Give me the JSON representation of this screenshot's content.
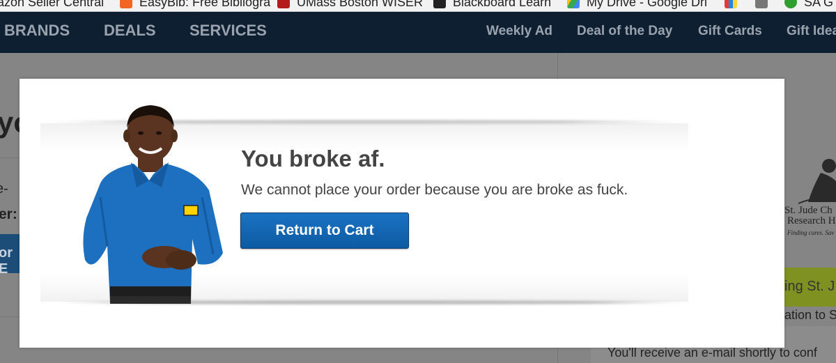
{
  "bookmarks": [
    {
      "label": "azon Seller Central",
      "icon": "amazon-icon",
      "color": "#f7f7f7"
    },
    {
      "label": "EasyBib: Free Bibliogra",
      "icon": "easybib-icon",
      "color": "#f26522"
    },
    {
      "label": "UMass Boston WISER",
      "icon": "umass-icon",
      "color": "#b31b1b"
    },
    {
      "label": "Blackboard Learn",
      "icon": "blackboard-icon",
      "color": "#222222"
    },
    {
      "label": "My Drive - Google Dri",
      "icon": "google-drive-icon",
      "color": "#34a853"
    },
    {
      "label": "SA G",
      "icon": "sa-icon",
      "color": "#2e9e2e"
    }
  ],
  "nav": {
    "left": [
      "BRANDS",
      "DEALS",
      "SERVICES"
    ],
    "right": [
      "Weekly Ad",
      "Deal of the Day",
      "Gift Cards",
      "Gift Idea"
    ]
  },
  "background": {
    "left_heading": "yo",
    "left_line1": "e-",
    "left_line2": "er:",
    "left_button": "or E",
    "stjude_name": "St. Jude Ch",
    "stjude_sub": "Research H",
    "stjude_tagline": "Finding cures. Sav",
    "green_text": "ing St. J",
    "bottom_line1": "ation to S",
    "bottom_line2": "You'll receive an e-mail shortly to conf"
  },
  "modal": {
    "title": "You broke af.",
    "message": "We cannot place your order because you are broke as fuck.",
    "button_label": "Return to Cart"
  },
  "colors": {
    "nav_bg": "#0e1f32",
    "button_blue": "#0d5aa3",
    "overlay_gray": "#858585"
  }
}
